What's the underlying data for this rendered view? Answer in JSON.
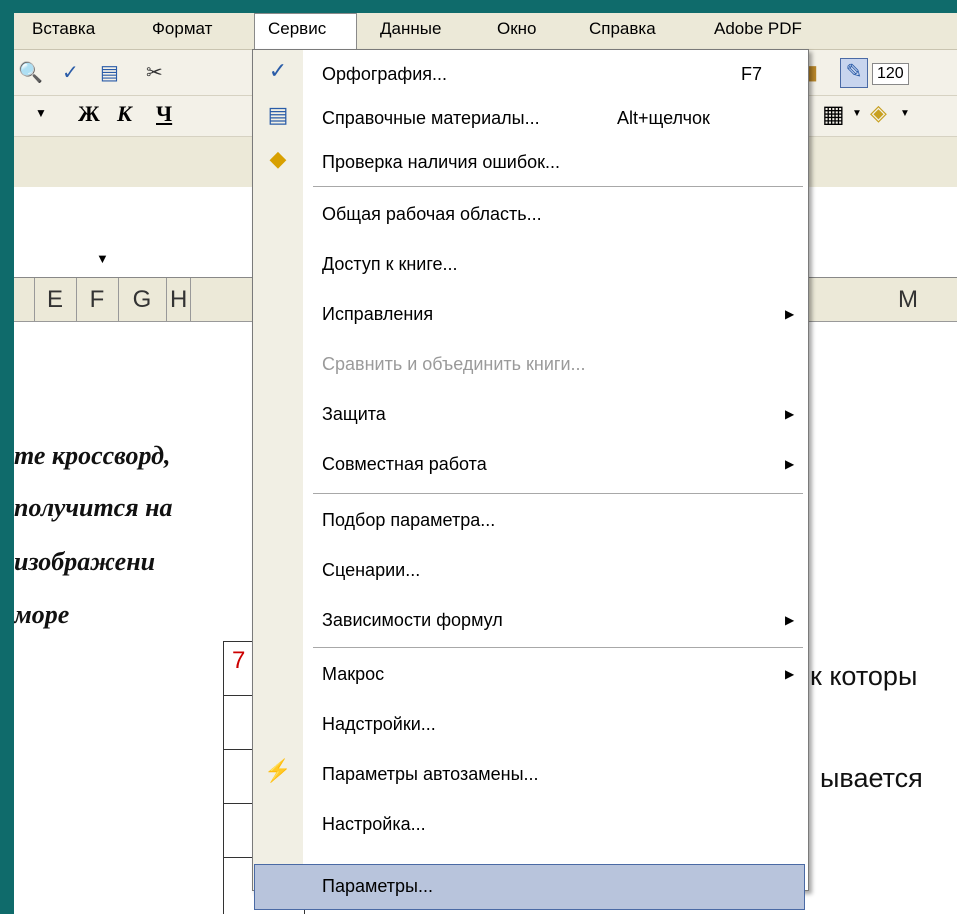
{
  "menubar": {
    "items": [
      "Вставка",
      "Формат",
      "Сервис",
      "Данные",
      "Окно",
      "Справка",
      "Adobe PDF"
    ]
  },
  "toolbar": {
    "zoom": "120",
    "bold": "Ж",
    "italic": "К",
    "underline": "Ч"
  },
  "columns": [
    "E",
    "F",
    "G",
    "H",
    "M"
  ],
  "sheet": {
    "lines": [
      "те кроссворд,",
      "получится на",
      "изображени",
      "море"
    ],
    "right_lines": [
      "к которы",
      "ывается"
    ],
    "cell_number": "7"
  },
  "menu": {
    "items": [
      {
        "label": "Орфография...",
        "shortcut": "F7",
        "icon": "spelling-icon"
      },
      {
        "label": "Справочные материалы...",
        "shortcut": "Alt+щелчок",
        "icon": "research-icon"
      },
      {
        "label": "Проверка наличия ошибок...",
        "icon": "error-check-icon"
      },
      {
        "label": "Общая рабочая область..."
      },
      {
        "label": "Доступ к книге..."
      },
      {
        "label": "Исправления",
        "submenu": true
      },
      {
        "label": "Сравнить и объединить книги...",
        "disabled": true
      },
      {
        "label": "Защита",
        "submenu": true
      },
      {
        "label": "Совместная работа",
        "submenu": true
      },
      {
        "label": "Подбор параметра..."
      },
      {
        "label": "Сценарии..."
      },
      {
        "label": "Зависимости формул",
        "submenu": true
      },
      {
        "label": "Макрос",
        "submenu": true
      },
      {
        "label": "Надстройки..."
      },
      {
        "label": "Параметры автозамены...",
        "icon": "autocorrect-icon"
      },
      {
        "label": "Настройка..."
      },
      {
        "label": "Параметры...",
        "highlighted": true
      }
    ]
  }
}
